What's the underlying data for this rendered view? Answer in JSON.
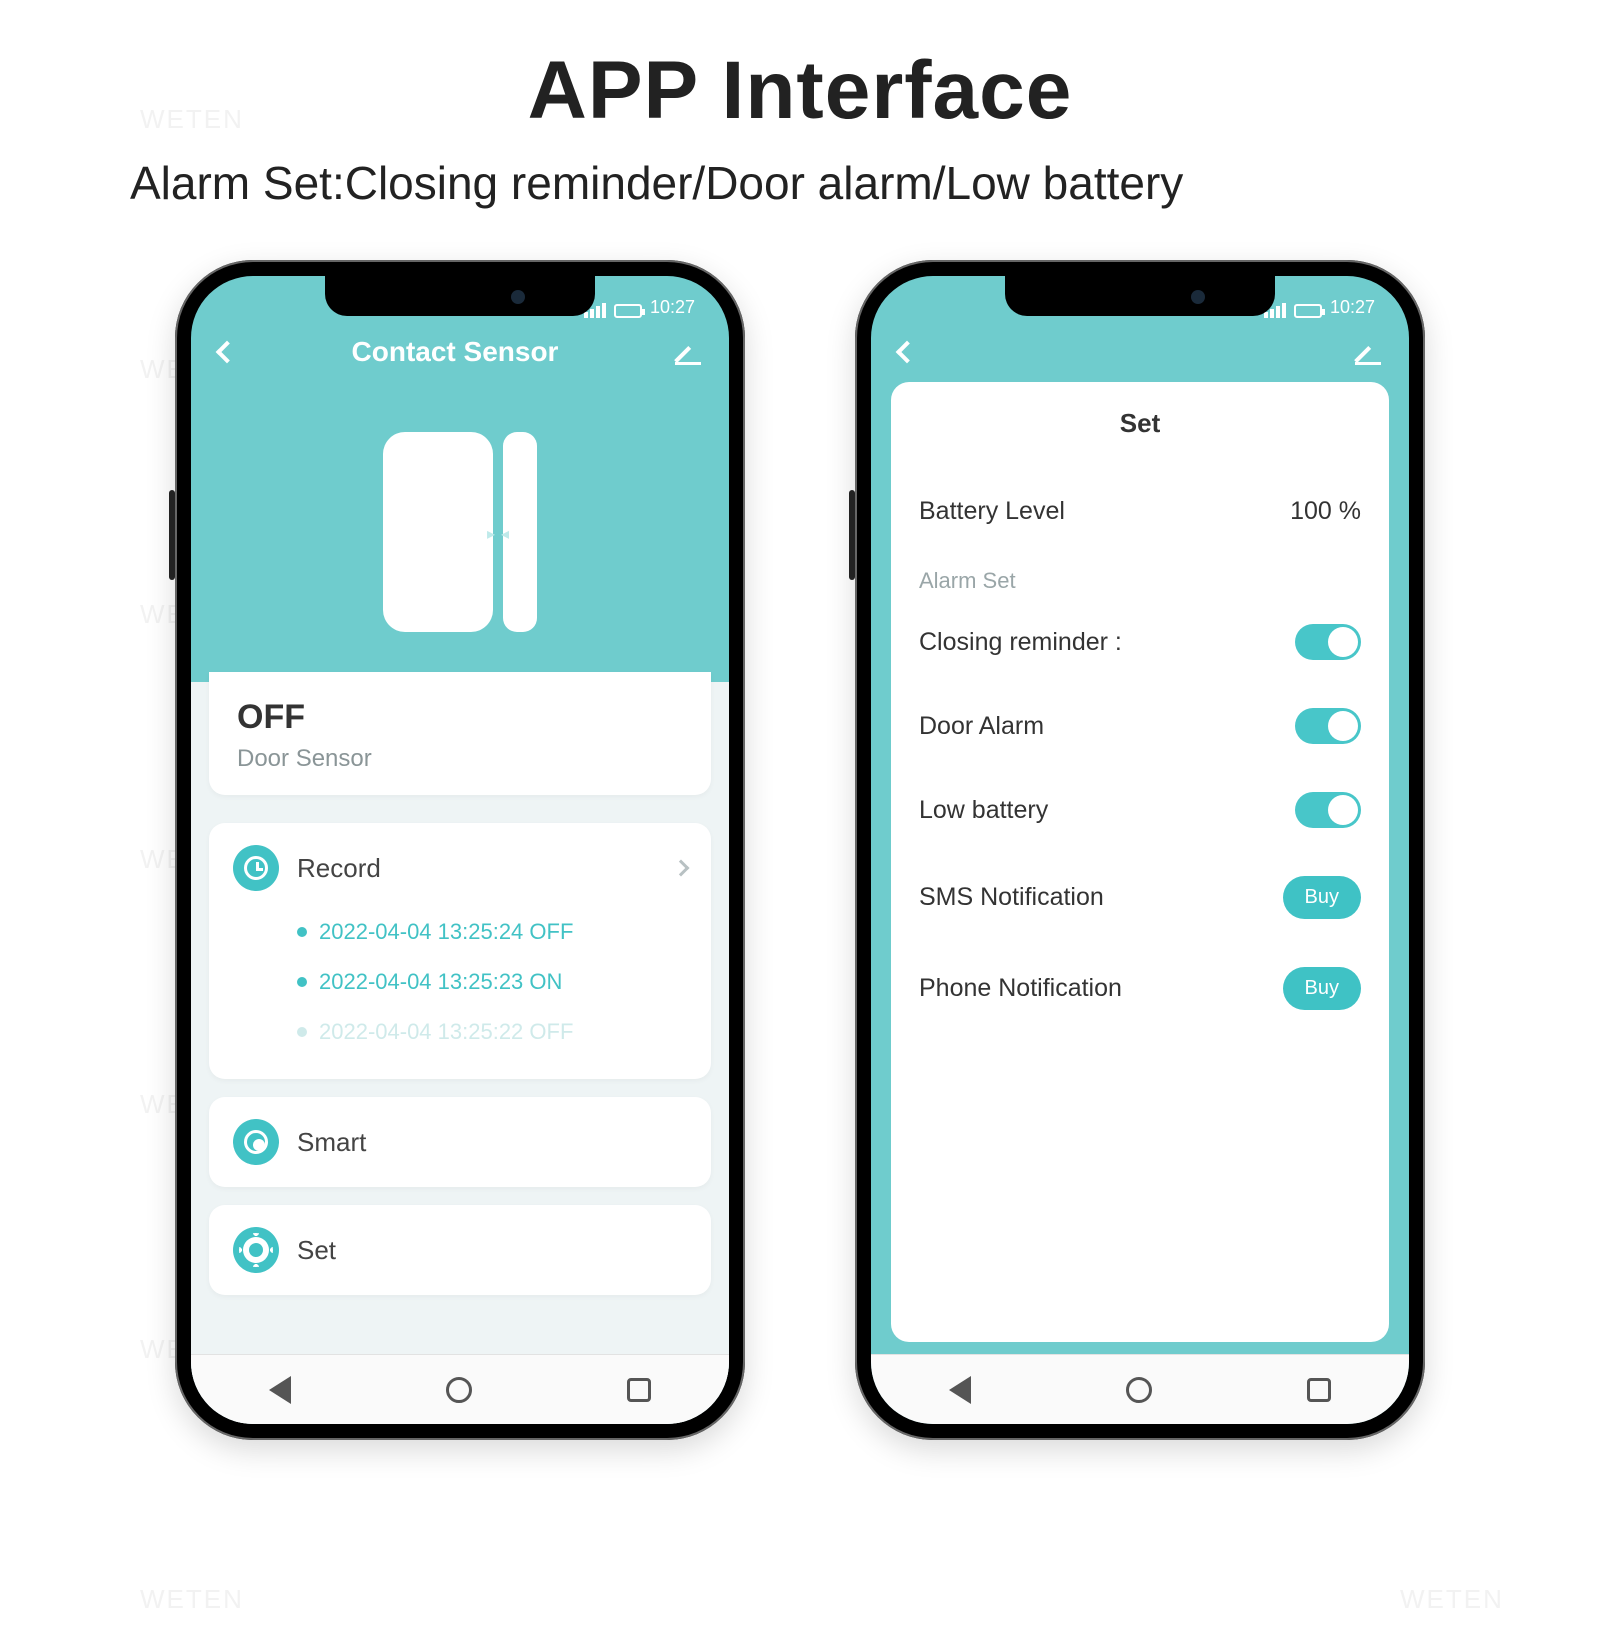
{
  "page": {
    "title": "APP Interface",
    "subtitle": "Alarm Set:Closing reminder/Door alarm/Low battery",
    "watermark": "WETEN"
  },
  "statusbar": {
    "time": "10:27"
  },
  "screen1": {
    "header_title": "Contact Sensor",
    "status": {
      "value": "OFF",
      "label": "Door Sensor"
    },
    "record": {
      "label": "Record",
      "items": [
        "2022-04-04 13:25:24 OFF",
        "2022-04-04 13:25:23 ON",
        "2022-04-04 13:25:22 OFF"
      ]
    },
    "smart_label": "Smart",
    "set_label": "Set"
  },
  "screen2": {
    "card_title": "Set",
    "battery": {
      "label": "Battery Level",
      "value": "100 %"
    },
    "section_label": "Alarm Set",
    "rows": {
      "closing": "Closing reminder :",
      "door": "Door Alarm",
      "low": "Low battery",
      "sms": "SMS Notification",
      "phone": "Phone Notification"
    },
    "buy_label": "Buy"
  }
}
